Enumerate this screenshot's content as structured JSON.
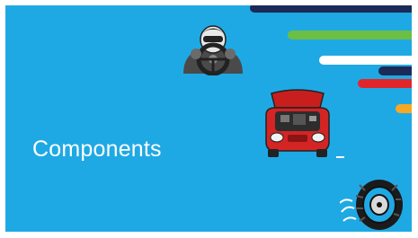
{
  "slide": {
    "title": "Components",
    "background_color": "#1fa9e4"
  },
  "decorations": {
    "stripes": [
      {
        "name": "navy-stripe-1",
        "color": "#1b2a57"
      },
      {
        "name": "green-stripe",
        "color": "#6cbe45"
      },
      {
        "name": "white-stripe",
        "color": "#ffffff"
      },
      {
        "name": "navy-stripe-2",
        "color": "#1b2a57"
      },
      {
        "name": "red-stripe",
        "color": "#e0262a"
      },
      {
        "name": "orange-stripe",
        "color": "#f7a823"
      }
    ]
  },
  "illustrations": [
    {
      "name": "driver-steering-wheel-icon"
    },
    {
      "name": "red-car-engine-icon"
    },
    {
      "name": "tire-icon"
    }
  ]
}
